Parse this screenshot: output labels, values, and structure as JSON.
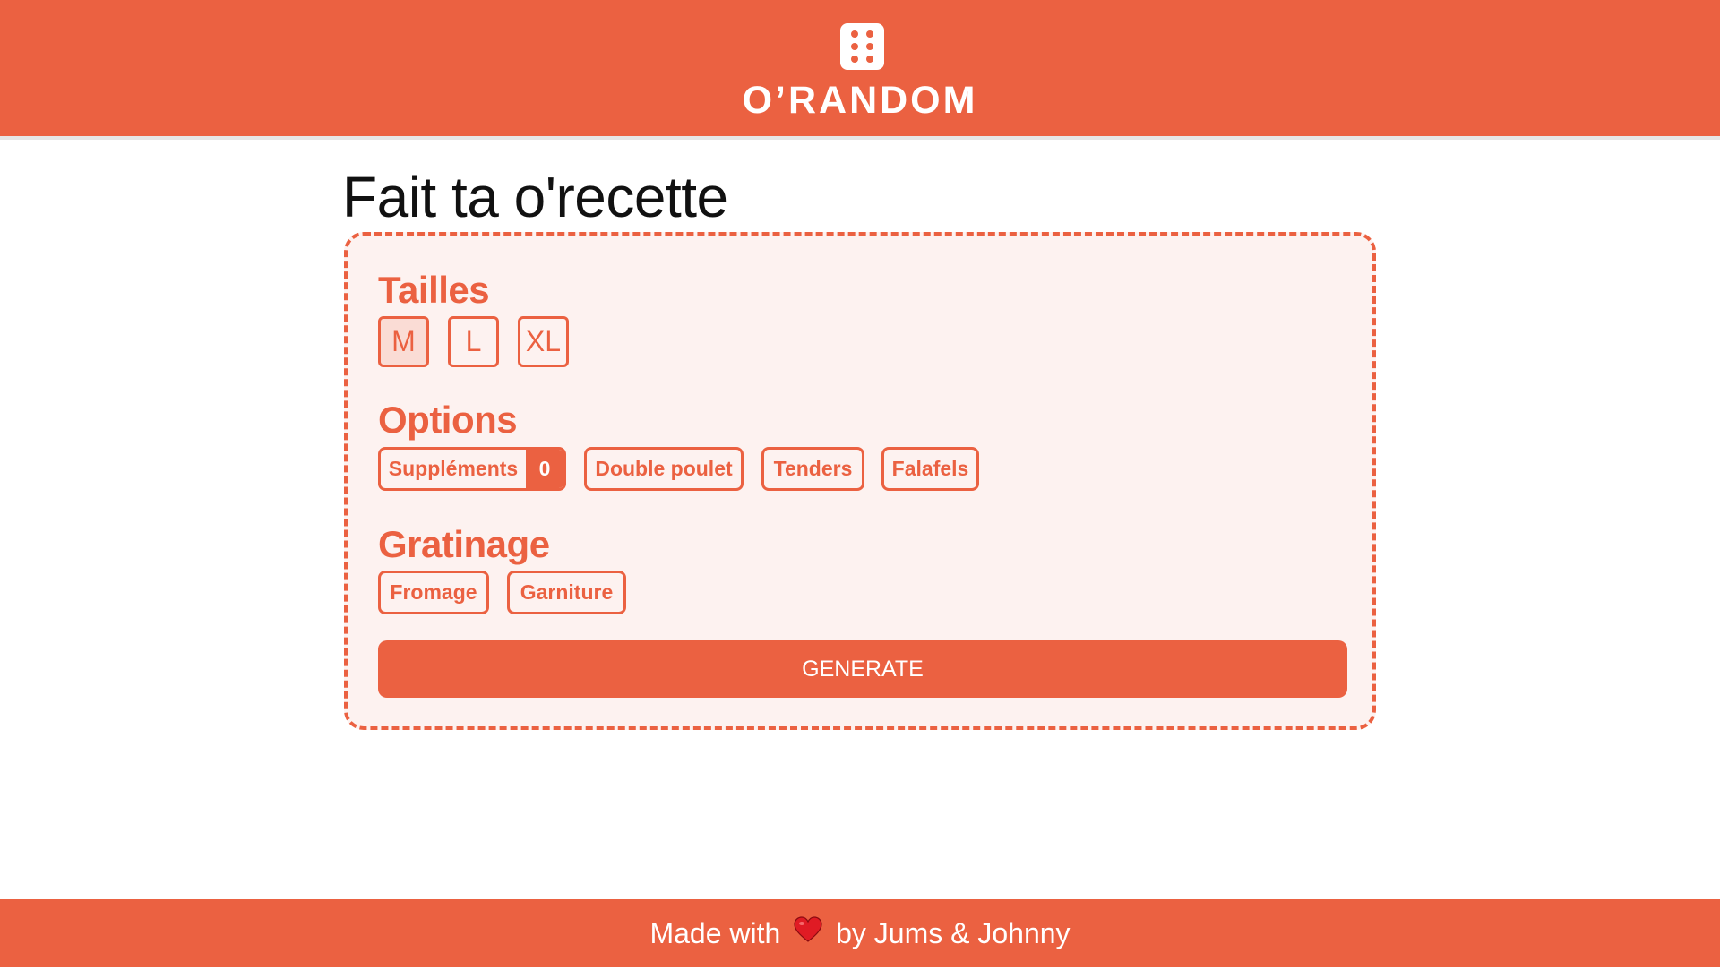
{
  "header": {
    "brand": "O’RANDOM",
    "logo_icon": "dice-six-icon"
  },
  "page": {
    "title": "Fait ta o'recette"
  },
  "form": {
    "sizes": {
      "title": "Tailles",
      "options": [
        "M",
        "L",
        "XL"
      ],
      "selected": "M"
    },
    "options": {
      "title": "Options",
      "supplements_label": "Suppléments",
      "supplements_count": "0",
      "choices": [
        "Double poulet",
        "Tenders",
        "Falafels"
      ]
    },
    "gratinage": {
      "title": "Gratinage",
      "choices": [
        "Fromage",
        "Garniture"
      ]
    },
    "generate_label": "GENERATE"
  },
  "footer": {
    "text_before": "Made with",
    "heart_icon": "heart-icon",
    "text_after": "by Jums & Johnny"
  },
  "colors": {
    "accent": "#eb6141",
    "card_background": "#fdf2f0",
    "selected_background": "#fadcd5",
    "text_dark": "#111111"
  }
}
